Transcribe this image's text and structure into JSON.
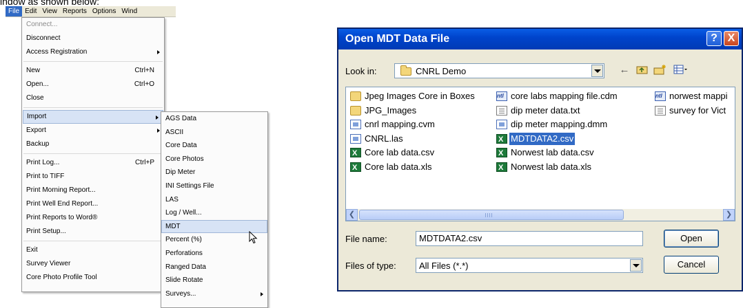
{
  "caption": "indow as shown below:",
  "menubar": [
    "File",
    "Edit",
    "View",
    "Reports",
    "Options",
    "Wind"
  ],
  "file_menu": [
    {
      "label": "Connect...",
      "disabled": true
    },
    {
      "label": "Disconnect"
    },
    {
      "label": "Access Registration",
      "submenu": true
    },
    {
      "sep": true
    },
    {
      "label": "New",
      "shortcut": "Ctrl+N"
    },
    {
      "label": "Open...",
      "shortcut": "Ctrl+O"
    },
    {
      "label": "Close"
    },
    {
      "sep": true
    },
    {
      "label": "Import",
      "submenu": true,
      "highlight": true
    },
    {
      "label": "Export",
      "submenu": true
    },
    {
      "label": "Backup"
    },
    {
      "sep": true
    },
    {
      "label": "Print Log...",
      "shortcut": "Ctrl+P"
    },
    {
      "label": "Print to TIFF"
    },
    {
      "label": "Print Morning Report..."
    },
    {
      "label": "Print Well End Report..."
    },
    {
      "label": "Print Reports to Word®"
    },
    {
      "label": "Print Setup..."
    },
    {
      "sep": true
    },
    {
      "label": "Exit"
    },
    {
      "label": "Survey Viewer"
    },
    {
      "label": "Core Photo Profile Tool"
    }
  ],
  "import_menu": [
    {
      "label": "AGS Data"
    },
    {
      "label": "ASCII"
    },
    {
      "label": "Core Data"
    },
    {
      "label": "Core Photos"
    },
    {
      "label": "Dip Meter"
    },
    {
      "label": "INI Settings File"
    },
    {
      "label": "LAS"
    },
    {
      "label": "Log / Well..."
    },
    {
      "label": "MDT",
      "highlight": true
    },
    {
      "label": "Percent (%)"
    },
    {
      "label": "Perforations"
    },
    {
      "label": "Ranged Data"
    },
    {
      "label": "Slide Rotate"
    },
    {
      "label": "Surveys...",
      "submenu": true
    }
  ],
  "dialog": {
    "title": "Open MDT Data File",
    "help_label": "?",
    "close_label": "X",
    "look_in_label": "Look in:",
    "look_in_value": "CNRL Demo",
    "files": [
      {
        "name": "Jpeg Images Core in Boxes",
        "type": "folder"
      },
      {
        "name": "JPG_Images",
        "type": "folder"
      },
      {
        "name": "cnrl mapping.cvm",
        "type": "app"
      },
      {
        "name": "CNRL.las",
        "type": "app"
      },
      {
        "name": "Core lab data.csv",
        "type": "csv"
      },
      {
        "name": "Core lab data.xls",
        "type": "csv"
      },
      {
        "name": "core labs mapping file.cdm",
        "type": "ntl"
      },
      {
        "name": "dip meter data.txt",
        "type": "doc"
      },
      {
        "name": "dip meter mapping.dmm",
        "type": "app"
      },
      {
        "name": "MDTDATA2.csv",
        "type": "csv",
        "selected": true
      },
      {
        "name": "Norwest lab data.csv",
        "type": "csv"
      },
      {
        "name": "Norwest lab data.xls",
        "type": "csv"
      },
      {
        "name": "norwest mappi",
        "type": "ntl"
      },
      {
        "name": "survey for Vict",
        "type": "doc"
      }
    ],
    "file_name_label": "File name:",
    "file_name_value": "MDTDATA2.csv",
    "files_of_type_label": "Files of type:",
    "files_of_type_value": "All Files (*.*)",
    "open_label": "Open",
    "cancel_label": "Cancel"
  }
}
